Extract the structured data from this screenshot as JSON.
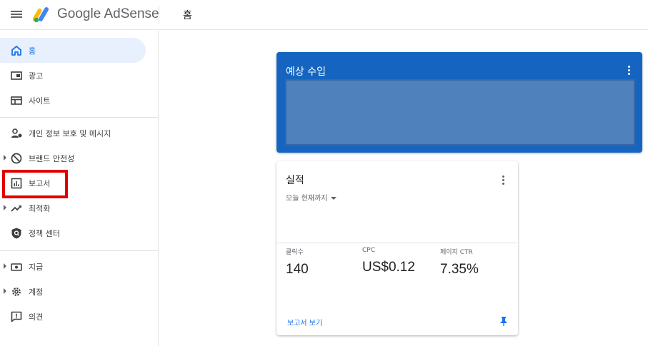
{
  "header": {
    "brand": "Google AdSense",
    "page_title": "홈"
  },
  "sidebar": {
    "items": [
      {
        "label": "홈",
        "icon": "home-icon",
        "active": true
      },
      {
        "label": "광고",
        "icon": "ads-icon"
      },
      {
        "label": "사이트",
        "icon": "sites-icon"
      },
      {
        "label": "개인 정보 보호 및 메시지",
        "icon": "privacy-messaging-icon"
      },
      {
        "label": "브랜드 안전성",
        "icon": "block-icon",
        "expandable": true
      },
      {
        "label": "보고서",
        "icon": "reports-icon",
        "highlighted": true
      },
      {
        "label": "최적화",
        "icon": "optimization-icon",
        "expandable": true
      },
      {
        "label": "정책 센터",
        "icon": "policy-center-icon"
      },
      {
        "label": "지급",
        "icon": "payments-icon",
        "expandable": true
      },
      {
        "label": "계정",
        "icon": "account-gear-icon",
        "expandable": true
      },
      {
        "label": "의견",
        "icon": "feedback-icon"
      }
    ]
  },
  "earnings_card": {
    "title": "예상 수입"
  },
  "performance_card": {
    "title": "실적",
    "range": "오늘 현재까지",
    "metrics": [
      {
        "label": "클릭수",
        "value": "140"
      },
      {
        "label": "CPC",
        "value": "US$0.12"
      },
      {
        "label": "페이지 CTR",
        "value": "7.35%"
      }
    ],
    "link": "보고서 보기"
  },
  "colors": {
    "accent": "#1a73e8",
    "earnings_card_bg": "#1565c0",
    "active_nav_bg": "#e8f0fe",
    "annotation_red": "#e00000"
  }
}
